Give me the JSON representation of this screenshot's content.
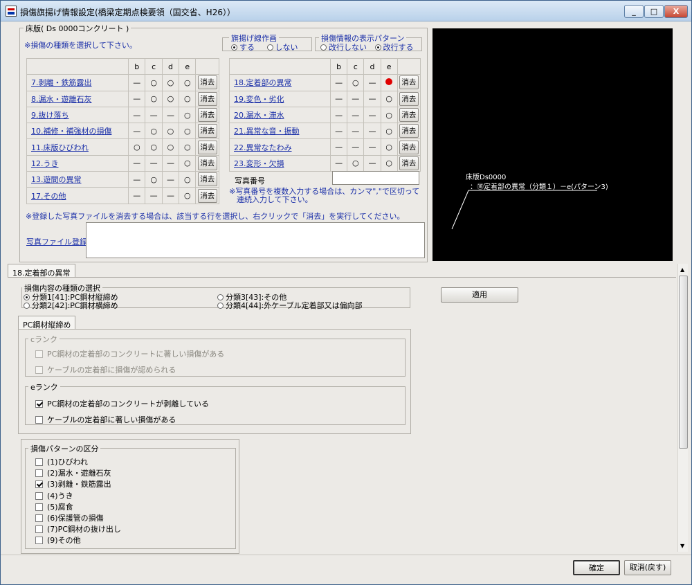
{
  "window": {
    "title": "損傷旗揚げ情報設定(橋梁定期点検要領（国交省、H26））",
    "min": "_",
    "max": "□",
    "close": "X"
  },
  "panel": {
    "legend": "床版( Ds 0000コンクリート )",
    "instruction": "※損傷の種類を選択して下さい。",
    "flag_line": {
      "legend": "旗揚げ線作画",
      "options": [
        "する",
        "しない"
      ],
      "selected": 0
    },
    "pattern": {
      "legend": "損傷情報の表示パターン",
      "options": [
        "改行しない",
        "改行する"
      ],
      "selected": 1
    },
    "headers": [
      "b",
      "c",
      "d",
      "e"
    ],
    "clear_label": "消去",
    "left_rows": [
      {
        "name": "7.剥離・鉄筋露出",
        "b": "—",
        "c": "○",
        "d": "○",
        "e": "○"
      },
      {
        "name": "8.漏水・遊離石灰",
        "b": "—",
        "c": "○",
        "d": "○",
        "e": "○"
      },
      {
        "name": "9.抜け落ち",
        "b": "—",
        "c": "—",
        "d": "—",
        "e": "○"
      },
      {
        "name": "10.補修・補強材の損傷",
        "b": "—",
        "c": "○",
        "d": "○",
        "e": "○"
      },
      {
        "name": "11.床版ひびわれ",
        "b": "○",
        "c": "○",
        "d": "○",
        "e": "○"
      },
      {
        "name": "12.うき",
        "b": "—",
        "c": "—",
        "d": "—",
        "e": "○"
      },
      {
        "name": "13.遊間の異常",
        "b": "—",
        "c": "○",
        "d": "—",
        "e": "○"
      },
      {
        "name": "17.その他",
        "b": "—",
        "c": "—",
        "d": "—",
        "e": "○"
      }
    ],
    "right_rows": [
      {
        "name": "18.定着部の異常",
        "b": "—",
        "c": "○",
        "d": "—",
        "e": "●"
      },
      {
        "name": "19.変色・劣化",
        "b": "—",
        "c": "—",
        "d": "—",
        "e": "○"
      },
      {
        "name": "20.漏水・滞水",
        "b": "—",
        "c": "—",
        "d": "—",
        "e": "○"
      },
      {
        "name": "21.異常な音・振動",
        "b": "—",
        "c": "—",
        "d": "—",
        "e": "○"
      },
      {
        "name": "22.異常なたわみ",
        "b": "—",
        "c": "—",
        "d": "—",
        "e": "○"
      },
      {
        "name": "23.変形・欠損",
        "b": "—",
        "c": "○",
        "d": "—",
        "e": "○"
      }
    ],
    "photo_no_label": "写真番号",
    "photo_no_value": "",
    "photo_note": "※写真番号を複数入力する場合は、カンマ\",\"で区切って\n　連続入力して下さい。",
    "delete_note": "※登録した写真ファイルを消去する場合は、該当する行を選択し、右クリックで「消去」を実行してください。",
    "photo_file_link": "写真ファイル登録",
    "photo_file_value": ""
  },
  "preview": {
    "label1": "床版Ds0000",
    "label2": "：⑱定着部の異常（分類１）－e(パターン3)",
    "accent": "#ffffff"
  },
  "tabs": {
    "main": "18.定着部の異常",
    "sub": "PC鋼材縦締め"
  },
  "damage_type": {
    "legend": "損傷内容の種類の選択",
    "options": [
      "分類1[41]:PC鋼材縦締め",
      "分類2[42]:PC鋼材横締め",
      "分類3[43]:その他",
      "分類4[44]:外ケーブル定着部又は偏向部"
    ],
    "selected": 0
  },
  "apply_label": "適用",
  "rank_c": {
    "legend": "cランク",
    "items": [
      "PC鋼材の定着部のコンクリートに著しい損傷がある",
      "ケーブルの定着部に損傷が認められる"
    ]
  },
  "rank_e": {
    "legend": "eランク",
    "items": [
      {
        "label": "PC鋼材の定着部のコンクリートが剥離している",
        "checked": true
      },
      {
        "label": "ケーブルの定着部に著しい損傷がある",
        "checked": false
      }
    ]
  },
  "pattern_class": {
    "legend": "損傷パターンの区分",
    "items": [
      {
        "label": "(1)ひびわれ",
        "checked": false
      },
      {
        "label": "(2)漏水・遊離石灰",
        "checked": false
      },
      {
        "label": "(3)剥離・鉄筋露出",
        "checked": true
      },
      {
        "label": "(4)うき",
        "checked": false
      },
      {
        "label": "(5)腐食",
        "checked": false
      },
      {
        "label": "(6)保護管の損傷",
        "checked": false
      },
      {
        "label": "(7)PC鋼材の抜け出し",
        "checked": false
      },
      {
        "label": "(9)その他",
        "checked": false
      }
    ]
  },
  "footer": {
    "ok": "確定",
    "cancel": "取消(戻す)"
  },
  "colors": {
    "active_mark": "#e00000",
    "link": "#1a2fa8"
  }
}
